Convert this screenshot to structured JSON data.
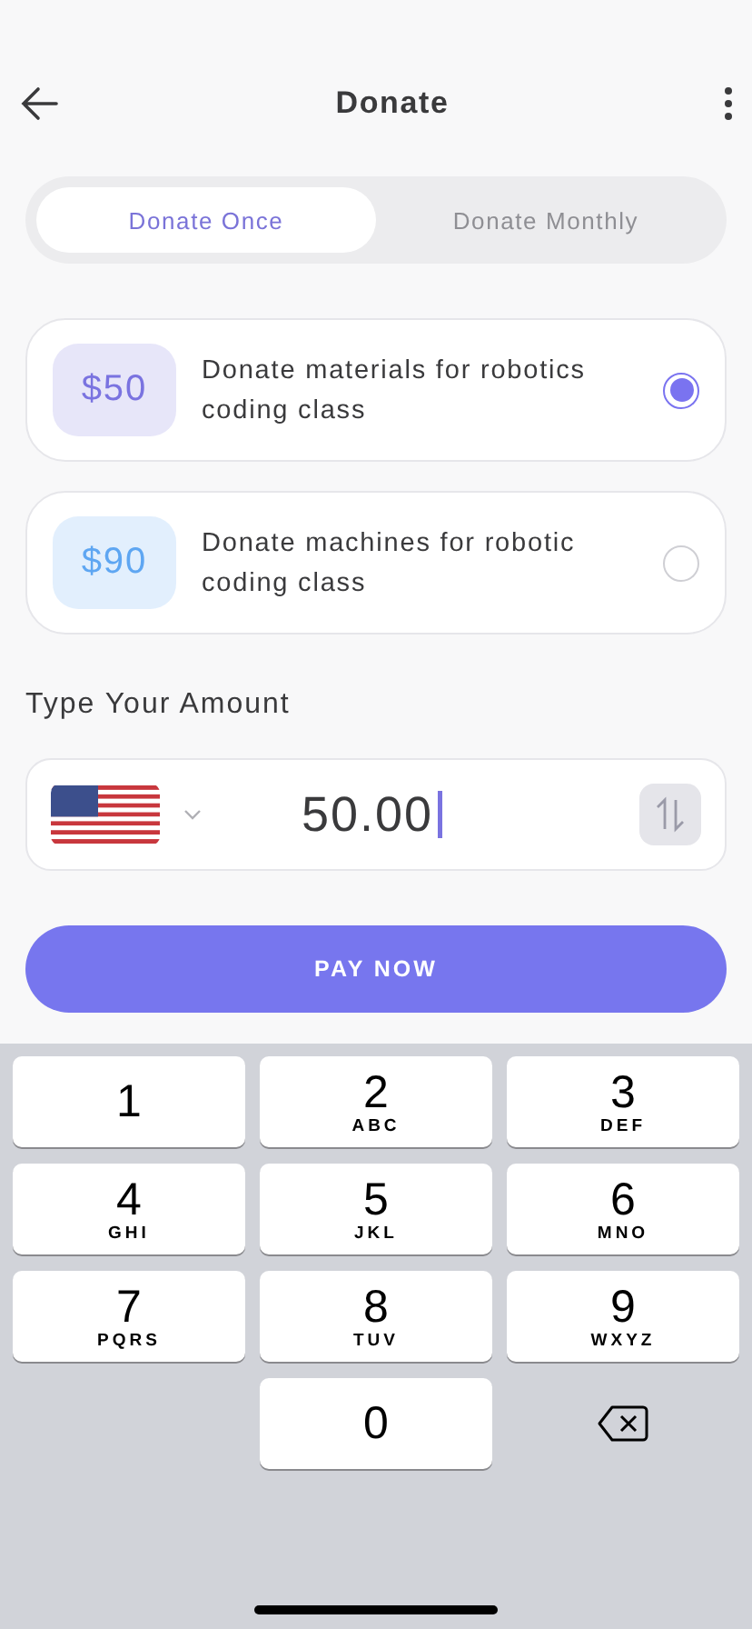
{
  "header": {
    "title": "Donate"
  },
  "tabs": [
    {
      "label": "Donate Once",
      "selected": true
    },
    {
      "label": "Donate Monthly",
      "selected": false
    }
  ],
  "options": [
    {
      "amount": "$50",
      "description": "Donate materials for robotics coding class",
      "color": "#7a73e0",
      "selected": true
    },
    {
      "amount": "$90",
      "description": "Donate machines for robotic coding class",
      "color": "#5ea6f2",
      "selected": false
    }
  ],
  "amount_section": {
    "label": "Type Your Amount",
    "value": "50.00"
  },
  "pay_button": "PAY NOW",
  "keyboard": {
    "rows": [
      [
        {
          "kind": "digit",
          "digit": "1"
        },
        {
          "kind": "digit",
          "digit": "2",
          "letters": "ABC"
        },
        {
          "kind": "digit",
          "digit": "3",
          "letters": "DEF"
        }
      ],
      [
        {
          "kind": "digit",
          "digit": "4",
          "letters": "GHI"
        },
        {
          "kind": "digit",
          "digit": "5",
          "letters": "JKL"
        },
        {
          "kind": "digit",
          "digit": "6",
          "letters": "MNO"
        }
      ],
      [
        {
          "kind": "digit",
          "digit": "7",
          "letters": "PQRS"
        },
        {
          "kind": "digit",
          "digit": "8",
          "letters": "TUV"
        },
        {
          "kind": "digit",
          "digit": "9",
          "letters": "WXYZ"
        }
      ],
      [
        {
          "kind": "empty"
        },
        {
          "kind": "digit",
          "digit": "0"
        },
        {
          "kind": "delete"
        }
      ]
    ]
  }
}
